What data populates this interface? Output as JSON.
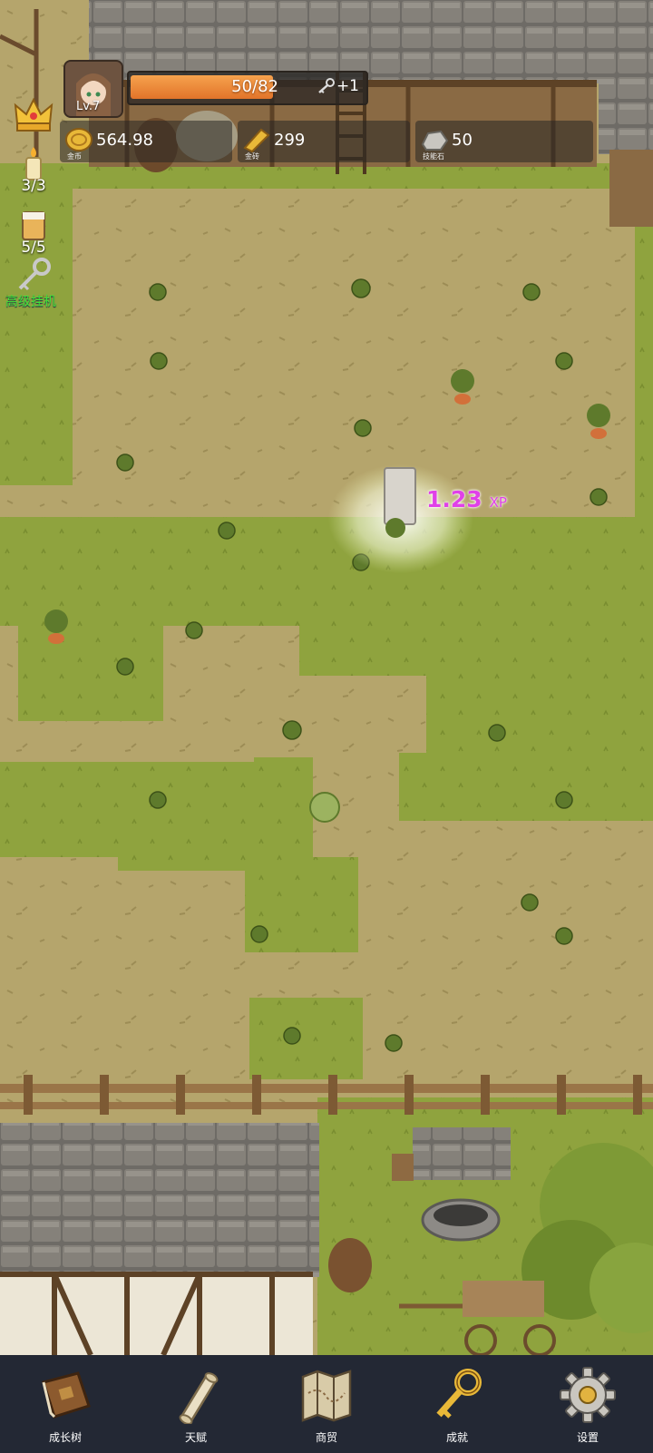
{
  "player": {
    "level": "Lv.7"
  },
  "xp": {
    "text": "50/82",
    "progress": 0.61,
    "key_bonus": "+1"
  },
  "resources": [
    {
      "name": "gold-coin",
      "value": "564.98",
      "caption": "金币"
    },
    {
      "name": "gold-brick",
      "value": "299",
      "caption": "金砖"
    },
    {
      "name": "skill-stone",
      "value": "50",
      "caption": "技能石"
    }
  ],
  "side": {
    "candle_count": "3/3",
    "beer_count": "5/5",
    "idle_label": "高级挂机"
  },
  "float_xp": {
    "value": "1.23",
    "unit": "XP"
  },
  "nav": [
    {
      "label": "成长树",
      "icon": "book-icon"
    },
    {
      "label": "天赋",
      "icon": "scroll-icon"
    },
    {
      "label": "商贸",
      "icon": "map-icon"
    },
    {
      "label": "成就",
      "icon": "golden-key-icon"
    },
    {
      "label": "设置",
      "icon": "gear-icon"
    }
  ],
  "colors": {
    "grass": "#8fa33e",
    "dirt": "#b5a56c",
    "xp_bar": "#ee8a38",
    "nav_bg": "#232834",
    "xp_float": "#e040e8",
    "idle_label": "#3fe33a"
  }
}
